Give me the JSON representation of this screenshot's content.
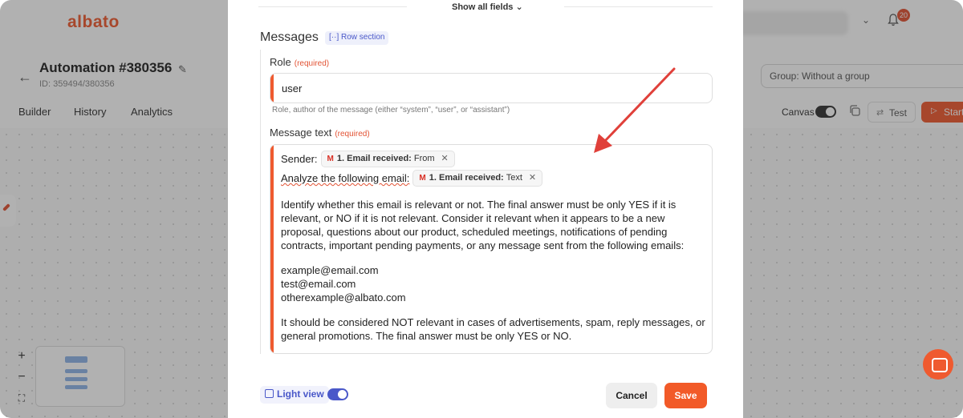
{
  "app": {
    "logo": "albato",
    "notifications_count": "20",
    "automation_title": "Automation #380356",
    "automation_id": "ID: 359494/380356",
    "tabs": [
      "Builder",
      "History",
      "Analytics"
    ],
    "group_select": "Group: Without a group",
    "canvas_label": "Canvas",
    "test_label": "Test",
    "start_label": "Start"
  },
  "modal": {
    "show_all_fields": "Show all fields",
    "section_title": "Messages",
    "row_section_badge": "Row section",
    "role": {
      "label": "Role",
      "required": "(required)",
      "value": "user",
      "hint": "Role, author of the message (either “system”, “user”, or “assistant”)"
    },
    "message_text": {
      "label": "Message text",
      "required": "(required)",
      "sender_label": "Sender:",
      "sender_chip": {
        "source": "1. Email received:",
        "field": "From"
      },
      "analyze_label": "Analyze the following email:",
      "analyze_chip": {
        "source": "1. Email received:",
        "field": "Text"
      },
      "paragraph1": " Identify whether this email is relevant or not. The final answer must be only YES if it is relevant, or NO if it is not relevant. Consider it relevant when it appears to be a new proposal, questions about our product, scheduled meetings, notifications of pending contracts, important pending payments, or any message sent from the following emails:",
      "emails": [
        "example@email.com",
        "test@email.com",
        "otherexample@albato.com"
      ],
      "paragraph2": " It should be considered NOT relevant in cases of advertisements, spam, reply messages, or general promotions. The final answer must be only YES or NO."
    },
    "light_view_label": "Light view",
    "light_view_on": true,
    "cancel_label": "Cancel",
    "save_label": "Save"
  },
  "colors": {
    "accent": "#ef5a2f",
    "link": "#4a58c9",
    "annotation_arrow": "#e0403a"
  }
}
